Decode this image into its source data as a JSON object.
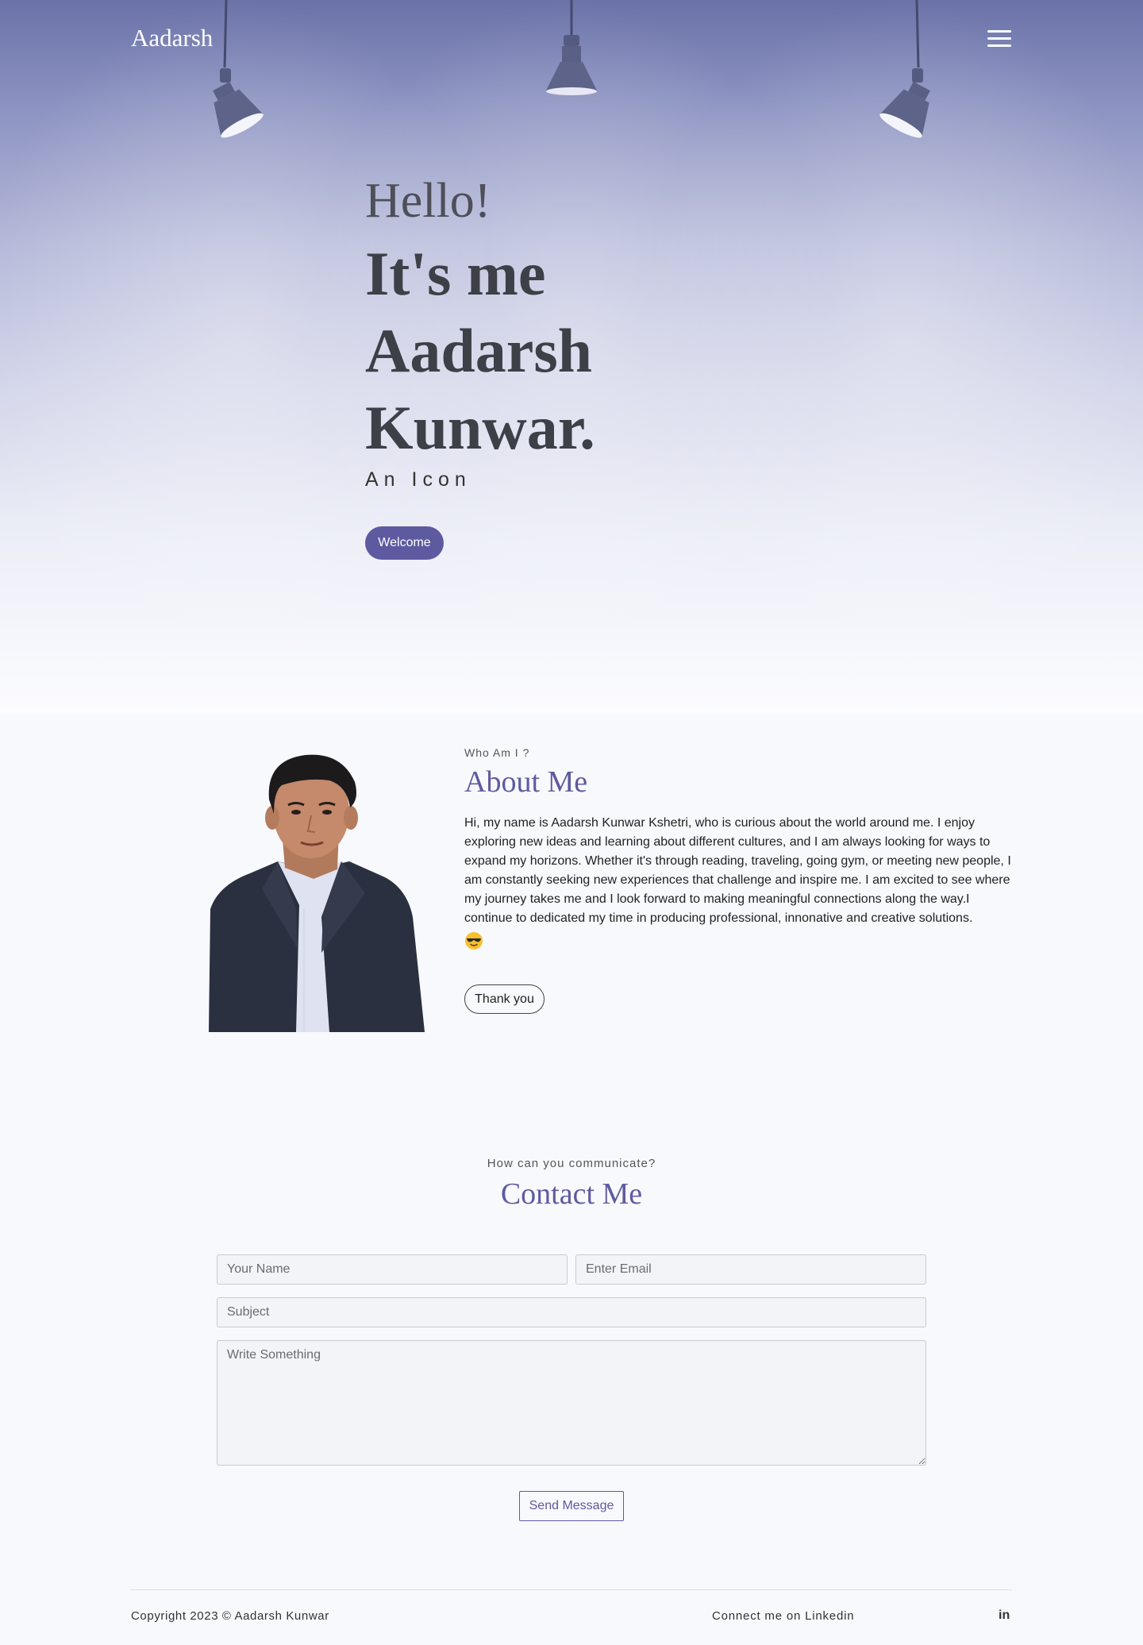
{
  "nav": {
    "brand": "Aadarsh",
    "menu_icon": "hamburger-menu-icon"
  },
  "hero": {
    "greeting": "Hello!",
    "headline_lines": [
      "It's me",
      "Aadarsh",
      "Kunwar."
    ],
    "tagline": "An Icon",
    "cta_label": "Welcome",
    "decor_icons": [
      "spotlight-lamp-icon",
      "spotlight-lamp-icon",
      "spotlight-lamp-icon"
    ]
  },
  "about": {
    "kicker": "Who Am I ?",
    "title": "About Me",
    "body": "Hi, my name is Aadarsh Kunwar Kshetri, who is curious about the world around me. I enjoy exploring new ideas and learning about different cultures, and I am always looking for ways to expand my horizons. Whether it's through reading, traveling, going gym, or meeting new people, I am constantly seeking new experiences that challenge and inspire me. I am excited to see where my journey takes me and I look forward to making meaningful connections along the way.I continue to dedicated my time in producing professional, innonative and creative solutions.",
    "emoji_icon": "sunglasses-face-emoji",
    "button_label": "Thank you"
  },
  "contact": {
    "kicker": "How can you communicate?",
    "title": "Contact Me",
    "name_placeholder": "Your Name",
    "email_placeholder": "Enter Email",
    "subject_placeholder": "Subject",
    "message_placeholder": "Write Something",
    "send_label": "Send Message"
  },
  "footer": {
    "copyright": "Copyright 2023 © Aadarsh Kunwar",
    "connect_label": "Connect me on Linkedin",
    "linkedin_icon_text": "in"
  },
  "colors": {
    "accent": "#5e5aa0",
    "hero_top": "#6a72a8",
    "heading_dark": "#3e4048"
  }
}
